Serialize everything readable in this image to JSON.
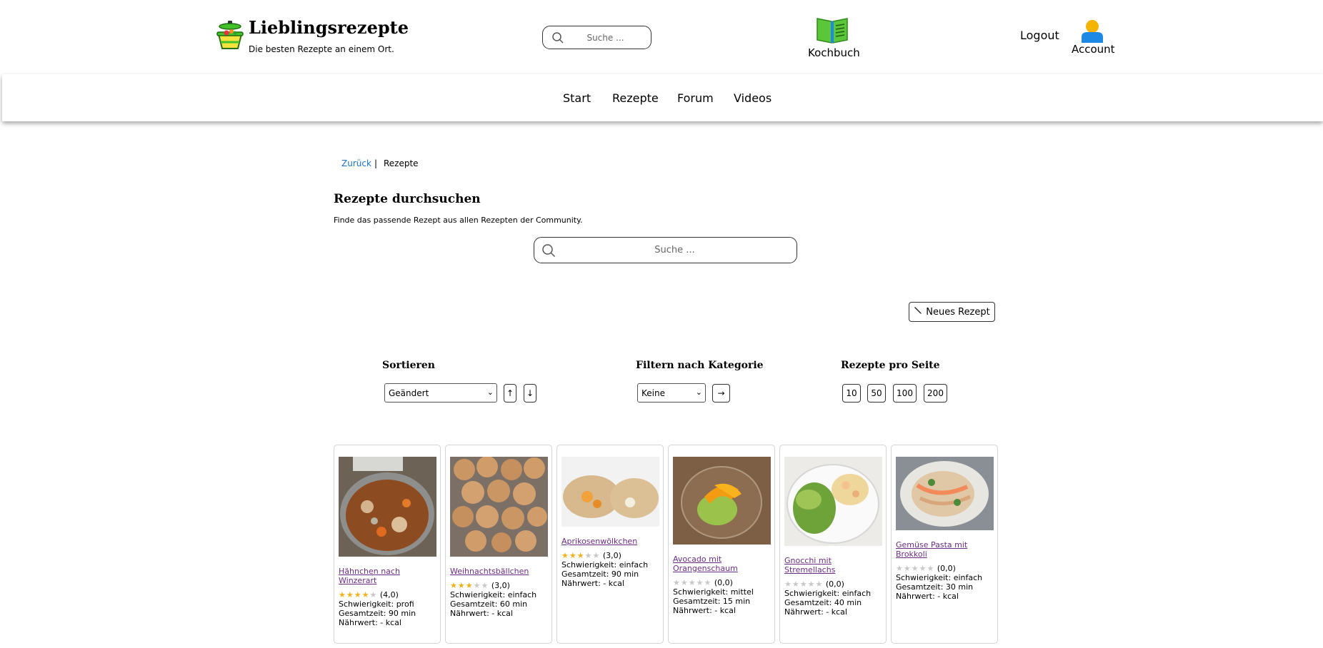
{
  "header": {
    "site_title": "Lieblingsrezepte",
    "site_subtitle": "Die besten Rezepte an einem Ort.",
    "search_placeholder": "Suche ...",
    "kochbuch_label": "Kochbuch",
    "logout_label": "Logout",
    "account_label": "Account"
  },
  "nav": {
    "items": [
      {
        "label": "Start"
      },
      {
        "label": "Rezepte"
      },
      {
        "label": "Forum"
      },
      {
        "label": "Videos"
      }
    ]
  },
  "breadcrumb": {
    "back": "Zurück",
    "separator": "|",
    "current": "Rezepte"
  },
  "main": {
    "heading": "Rezepte durchsuchen",
    "description": "Finde das passende Rezept aus allen Rezepten der Community.",
    "search_placeholder": "Suche ...",
    "new_recipe_label": "Neues Rezept"
  },
  "controls": {
    "sort": {
      "heading": "Sortieren",
      "selected": "Geändert",
      "asc_label": "↑",
      "desc_label": "↓"
    },
    "filter": {
      "heading": "Filtern nach Kategorie",
      "selected": "Keine",
      "apply_label": "→"
    },
    "per_page": {
      "heading": "Rezepte pro Seite",
      "options": [
        "10",
        "50",
        "100",
        "200"
      ]
    }
  },
  "recipes": [
    {
      "title": "Hähnchen nach Winzerart",
      "rating": 4,
      "rating_text": "(4,0)",
      "difficulty": "Schwierigkeit: profi",
      "time": "Gesamtzeit: 90 min",
      "nutrition": "Nährwert: - kcal"
    },
    {
      "title": "Weihnachtsbällchen",
      "rating": 3,
      "rating_text": "(3,0)",
      "difficulty": "Schwierigkeit: einfach",
      "time": "Gesamtzeit: 60 min",
      "nutrition": "Nährwert: - kcal"
    },
    {
      "title": "Aprikosenwölkchen",
      "rating": 3,
      "rating_text": "(3,0)",
      "difficulty": "Schwierigkeit: einfach",
      "time": "Gesamtzeit: 90 min",
      "nutrition": "Nährwert: - kcal"
    },
    {
      "title": "Avocado mit Orangenschaum",
      "rating": 0,
      "rating_text": "(0,0)",
      "difficulty": "Schwierigkeit: mittel",
      "time": "Gesamtzeit: 15 min",
      "nutrition": "Nährwert: - kcal"
    },
    {
      "title": "Gnocchi mit Stremellachs",
      "rating": 0,
      "rating_text": "(0,0)",
      "difficulty": "Schwierigkeit: einfach",
      "time": "Gesamtzeit: 40 min",
      "nutrition": "Nährwert: - kcal"
    },
    {
      "title": "Gemüse Pasta mit Brokkoli",
      "rating": 0,
      "rating_text": "(0,0)",
      "difficulty": "Schwierigkeit: einfach",
      "time": "Gesamtzeit: 30 min",
      "nutrition": "Nährwert: - kcal"
    }
  ],
  "icons": {
    "logo": "cooking-pot-icon",
    "search": "search-icon",
    "kochbuch": "open-book-icon",
    "account": "user-icon",
    "new_recipe": "pencil-icon"
  },
  "colors": {
    "link": "#1a73c9",
    "recipe_link": "#6b2c84",
    "star_on": "#f1b11c",
    "star_off": "#c8c8c8",
    "book_green": "#5cc63a",
    "account_blue": "#1e88e5",
    "account_yellow": "#f5b400"
  }
}
